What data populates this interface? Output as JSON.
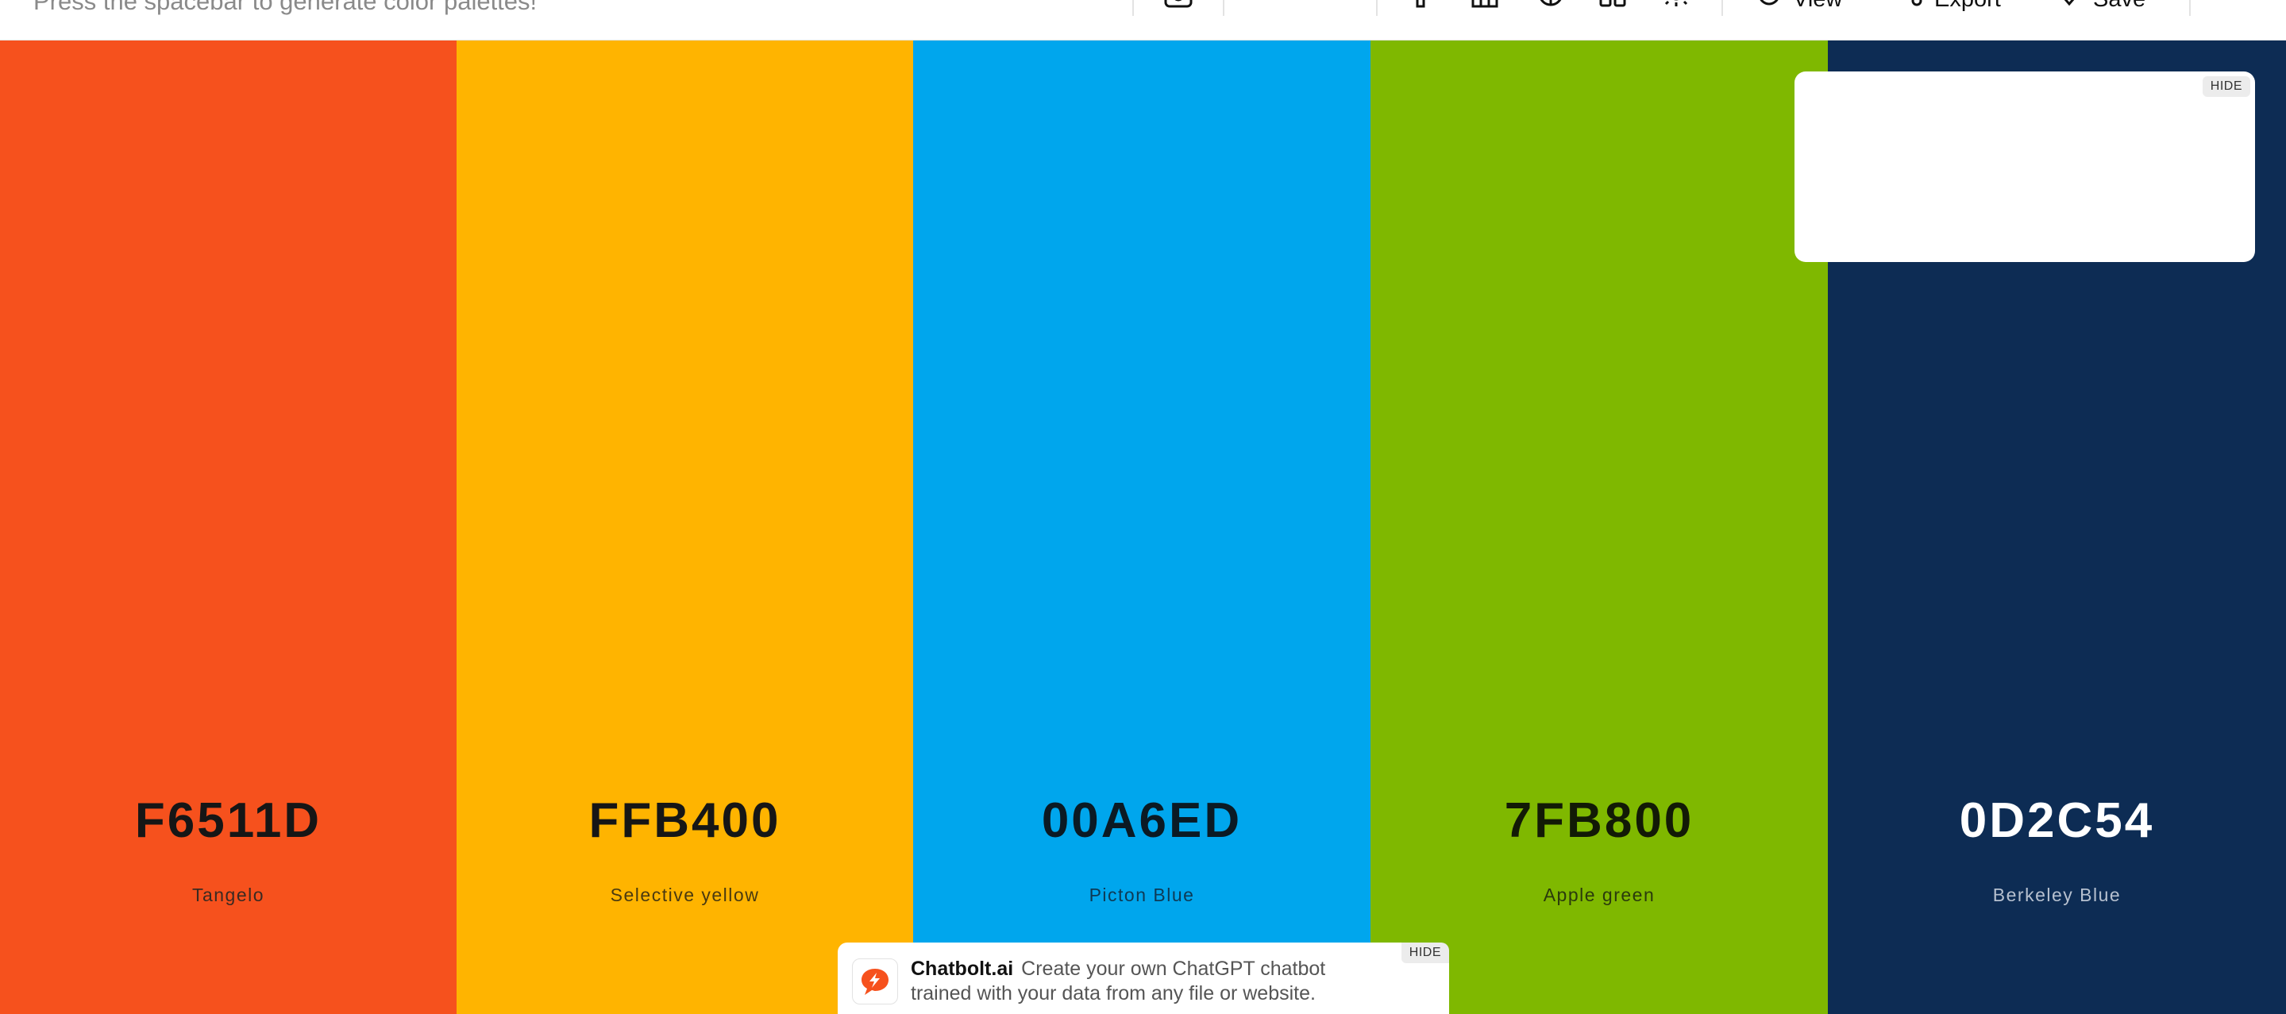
{
  "header": {
    "hint": "Press the spacebar to generate color palettes!",
    "buttons": {
      "view": "View",
      "export": "Export",
      "save": "Save"
    }
  },
  "palette": [
    {
      "hex": "F6511D",
      "name": "Tangelo",
      "color": "#F6511D",
      "text_color": "#161616",
      "name_color": "#3a2a22"
    },
    {
      "hex": "FFB400",
      "name": "Selective yellow",
      "color": "#FFB400",
      "text_color": "#161616",
      "name_color": "#4a3a10"
    },
    {
      "hex": "00A6ED",
      "name": "Picton Blue",
      "color": "#00A6ED",
      "text_color": "#0b1a24",
      "name_color": "#0e3a55"
    },
    {
      "hex": "7FB800",
      "name": "Apple green",
      "color": "#7FB800",
      "text_color": "#121a06",
      "name_color": "#2a3a0c"
    },
    {
      "hex": "0D2C54",
      "name": "Berkeley Blue",
      "color": "#0D2C54",
      "text_color": "#ffffff",
      "name_color": "#b6c0cf"
    }
  ],
  "ads": {
    "side": {
      "hide_label": "HIDE"
    },
    "bottom": {
      "hide_label": "HIDE",
      "brand": "Chatbolt.ai",
      "text": "Create your own ChatGPT chatbot trained with your data from any file or website."
    }
  }
}
